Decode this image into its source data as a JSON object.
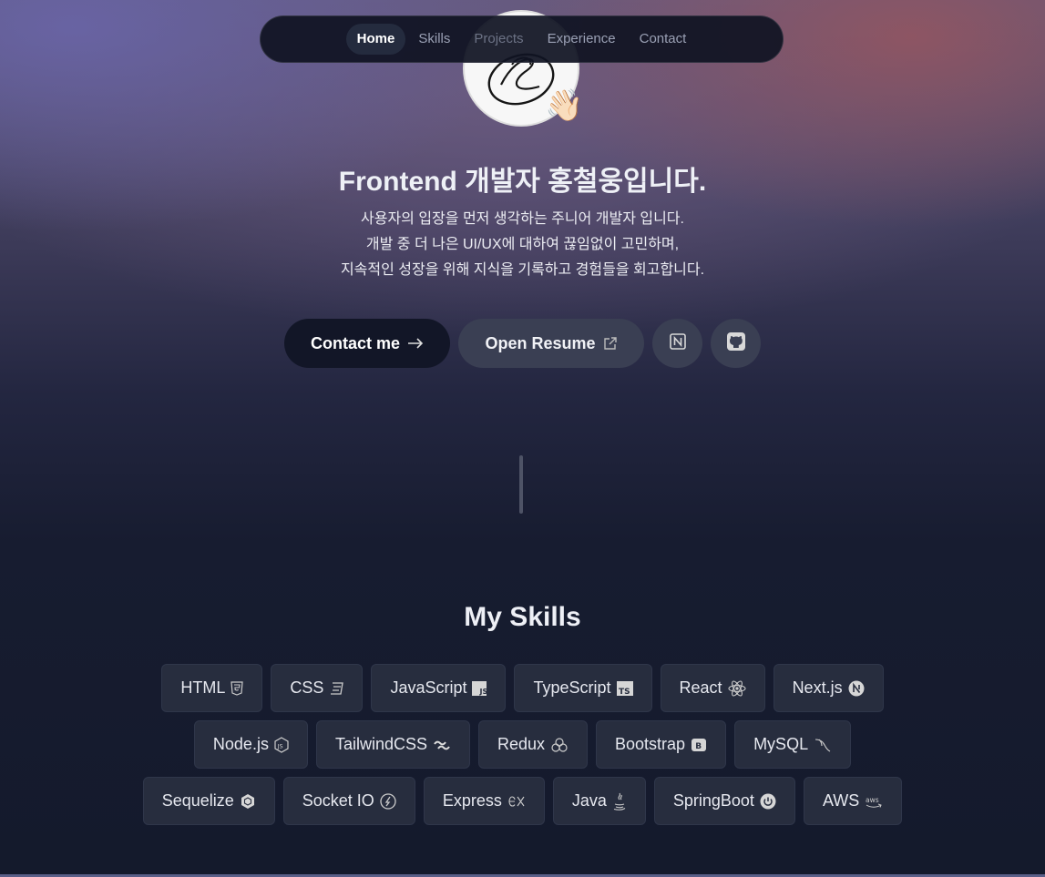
{
  "nav": {
    "items": [
      {
        "label": "Home",
        "active": true
      },
      {
        "label": "Skills"
      },
      {
        "label": "Projects"
      },
      {
        "label": "Experience"
      },
      {
        "label": "Contact"
      }
    ]
  },
  "hero": {
    "title": "Frontend 개발자 홍철웅입니다.",
    "intro_lines": [
      "사용자의 입장을 먼저 생각하는 주니어 개발자 입니다.",
      "개발 중 더 나은 UI/UX에 대하여 끊임없이 고민하며,",
      "지속적인 성장을 위해 지식을 기록하고 경험들을 회고합니다."
    ],
    "wave_emoji": "👋🏻"
  },
  "buttons": {
    "contact": "Contact me",
    "resume": "Open Resume",
    "notion_icon": "notion-icon",
    "github_icon": "github-icon"
  },
  "skills": {
    "title": "My Skills",
    "rows": [
      [
        {
          "label": "HTML",
          "icon": "html5-icon"
        },
        {
          "label": "CSS",
          "icon": "css3-icon"
        },
        {
          "label": "JavaScript",
          "icon": "js-icon"
        },
        {
          "label": "TypeScript",
          "icon": "ts-icon"
        },
        {
          "label": "React",
          "icon": "react-icon"
        },
        {
          "label": "Next.js",
          "icon": "nextjs-icon"
        }
      ],
      [
        {
          "label": "Node.js",
          "icon": "nodejs-icon"
        },
        {
          "label": "TailwindCSS",
          "icon": "tailwind-icon"
        },
        {
          "label": "Redux",
          "icon": "redux-icon"
        },
        {
          "label": "Bootstrap",
          "icon": "bootstrap-icon"
        },
        {
          "label": "MySQL",
          "icon": "mysql-icon"
        }
      ],
      [
        {
          "label": "Sequelize",
          "icon": "sequelize-icon"
        },
        {
          "label": "Socket IO",
          "icon": "socketio-icon"
        },
        {
          "label": "Express",
          "icon": "express-icon"
        },
        {
          "label": "Java",
          "icon": "java-icon"
        },
        {
          "label": "SpringBoot",
          "icon": "springboot-icon"
        },
        {
          "label": "AWS",
          "icon": "aws-icon"
        }
      ]
    ]
  },
  "colors": {
    "accent_dark": "#121627",
    "chip_bg": "#272d3e",
    "text": "#e8eaf2"
  }
}
